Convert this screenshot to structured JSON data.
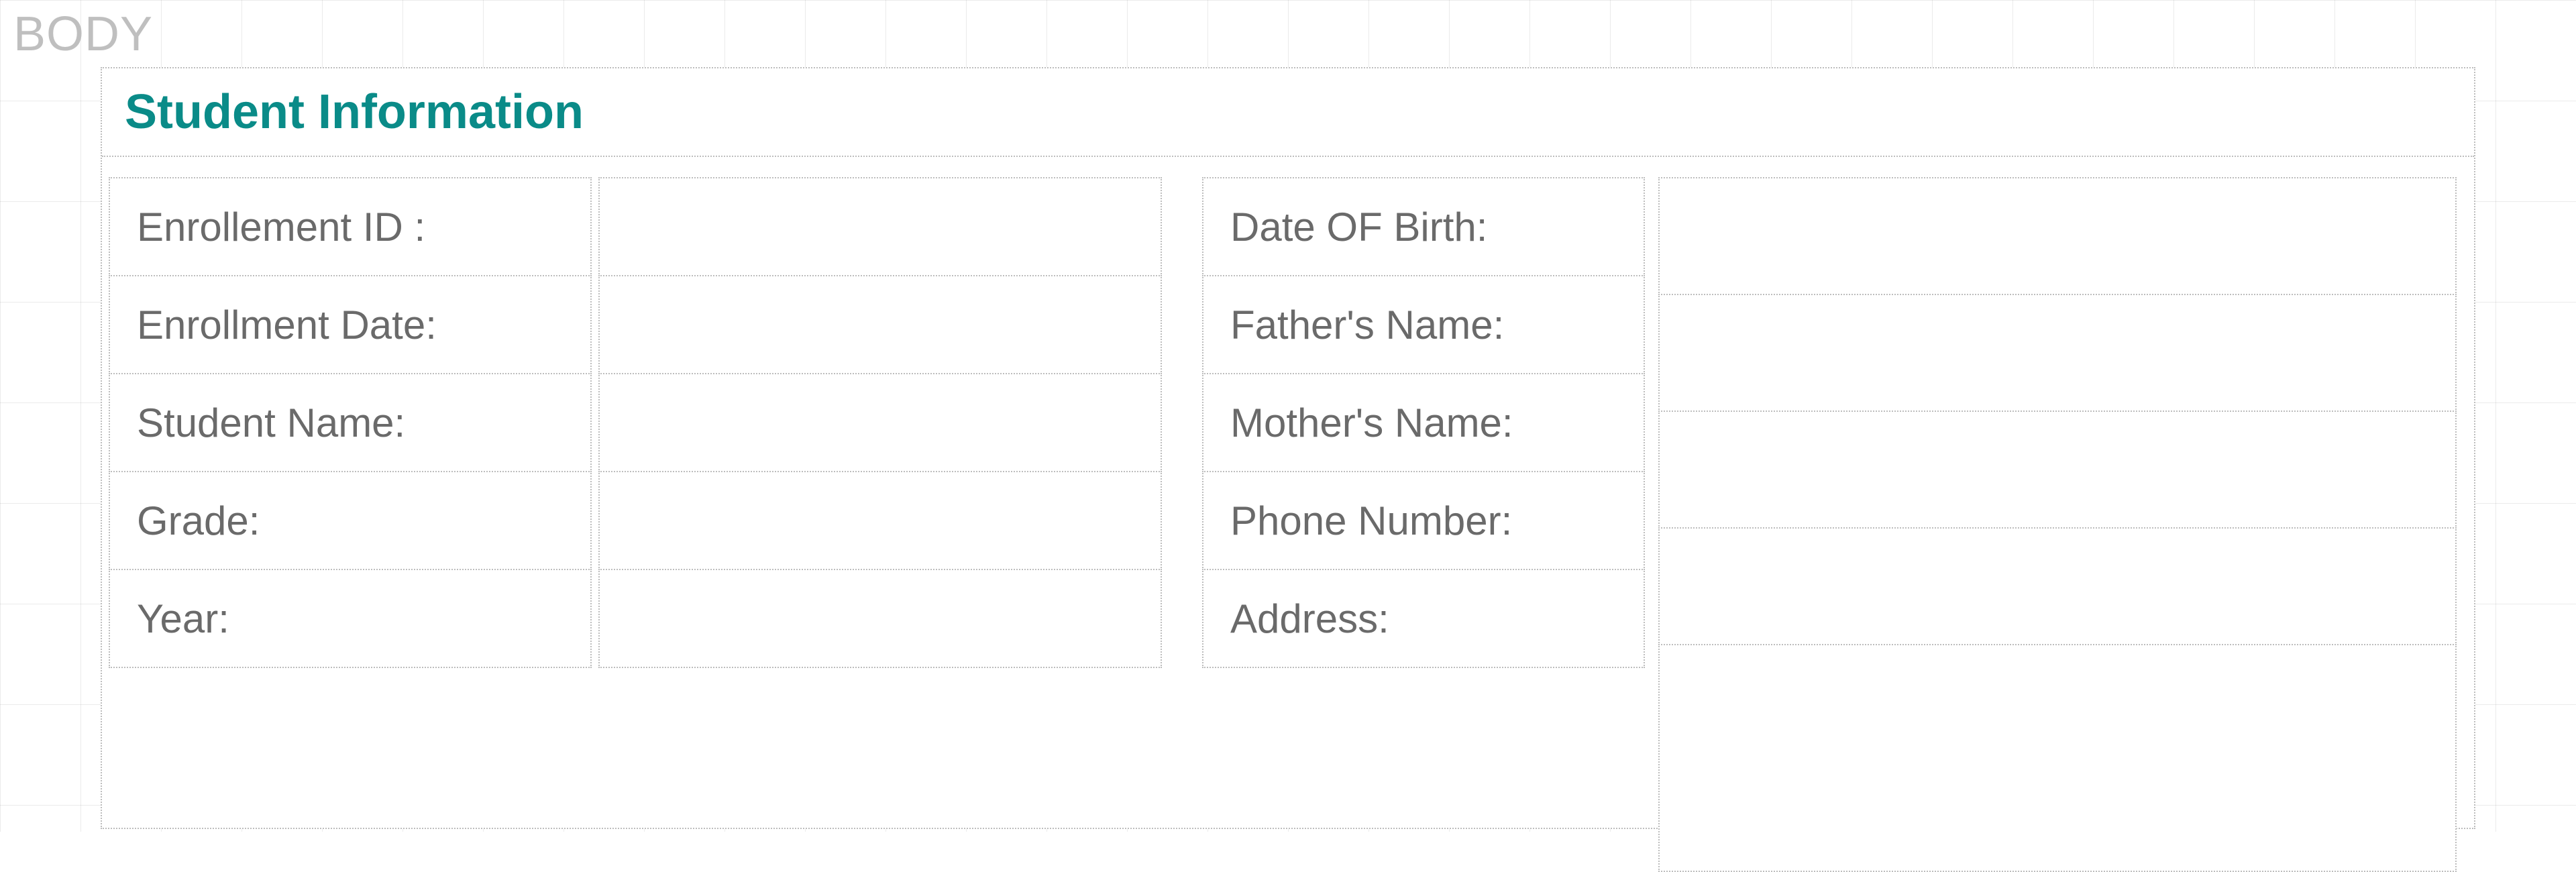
{
  "designer": {
    "body_tag": "BODY"
  },
  "section": {
    "title": "Student Information"
  },
  "left": {
    "labels": {
      "enrollment_id": "Enrollement ID :",
      "enrollment_date": "Enrollment Date:",
      "student_name": "Student Name:",
      "grade": "Grade:",
      "year": "Year:"
    },
    "values": {
      "enrollment_id": "",
      "enrollment_date": "",
      "student_name": "",
      "grade": "",
      "year": ""
    }
  },
  "right": {
    "labels": {
      "dob": "Date OF Birth:",
      "father_name": "Father's Name:",
      "mother_name": "Mother's Name:",
      "phone": "Phone Number:",
      "address": "Address:"
    },
    "values": {
      "dob": "",
      "father_name": "",
      "mother_name": "",
      "phone": "",
      "address": ""
    }
  }
}
